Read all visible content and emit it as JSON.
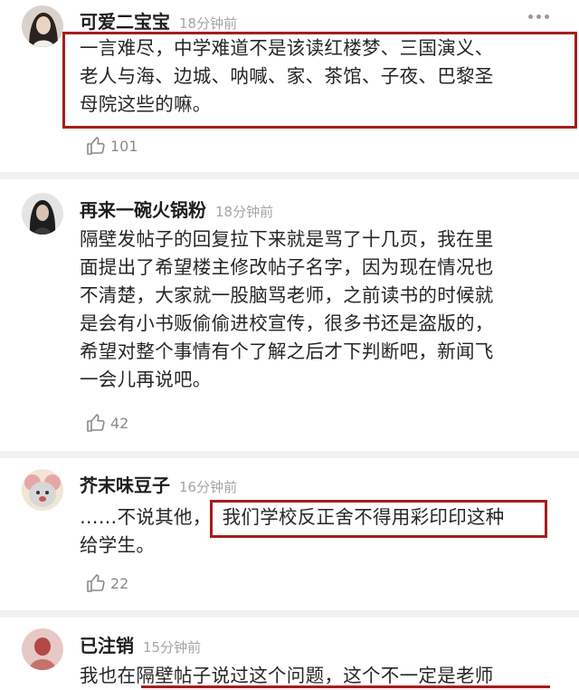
{
  "comments": [
    {
      "user": "可爱二宝宝",
      "time": "18分钟前",
      "lines": [
        "一言难尽，中学难道不是该读红楼梦、三国演义、",
        "老人与海、边城、呐喊、家、茶馆、子夜、巴黎圣",
        "母院这些的嘛。"
      ],
      "likes": "101"
    },
    {
      "user": "再来一碗火锅粉",
      "time": "18分钟前",
      "lines": [
        "隔壁发帖子的回复拉下来就是骂了十几页，我在里",
        "面提出了希望楼主修改帖子名字，因为现在情况也",
        "不清楚，大家就一股脑骂老师，之前读书的时候就",
        "是会有小书贩偷偷进校宣传，很多书还是盗版的，",
        "希望对整个事情有个了解之后才下判断吧，新闻飞",
        "一会儿再说吧。"
      ],
      "likes": "42"
    },
    {
      "user": "芥末味豆子",
      "time": "16分钟前",
      "lines": [
        "……不说其他，",
        "我们学校反正舍不得用彩印印这种",
        "给学生。"
      ],
      "likes": "22"
    },
    {
      "user": "已注销",
      "time": "15分钟前",
      "lines": [
        "我也在",
        "隔壁帖子说过这个问题，这个不一定是老师"
      ]
    }
  ],
  "colors": {
    "highlight": "#a61c1c",
    "divider": "#f1f1f1",
    "meta": "#a5a5a5"
  },
  "icons": {
    "like": "thumbs-up-icon",
    "more": "more-dots-icon"
  }
}
